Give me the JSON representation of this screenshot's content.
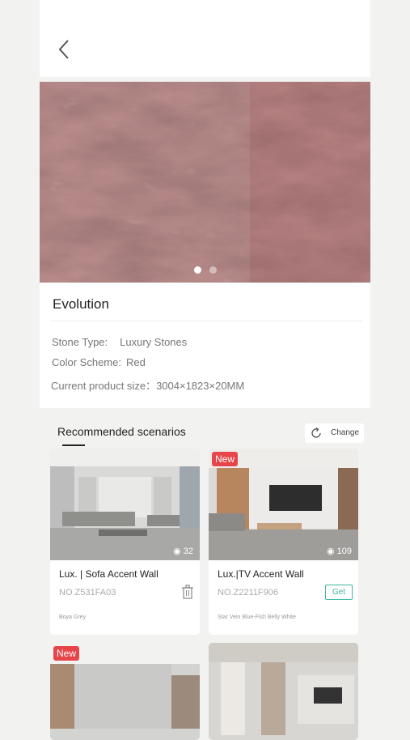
{
  "product": {
    "name": "Evolution",
    "specs": [
      {
        "label": "Stone Type:",
        "value": "Luxury Stones"
      },
      {
        "label": "Color Scheme:",
        "value": "Red"
      },
      {
        "label": "Current product size：",
        "value": "3004×1823×20MM"
      }
    ],
    "carousel": {
      "count": 2,
      "active": 1
    }
  },
  "recommended": {
    "title": "Recommended scenarios",
    "change_label": "Change",
    "cards": [
      {
        "name": "Lux. | Sofa Accent Wall",
        "code": "NO.Z531FA03",
        "stone": "Boya Grey",
        "views": "32",
        "badge": "",
        "action": "delete-icon"
      },
      {
        "name": "Lux.|TV Accent Wall",
        "code": "NO.Z2211F906",
        "stone": "Star Vein Blue-Fish Belly White",
        "views": "109",
        "badge": "New",
        "action_label": "Get"
      },
      {
        "badge": "New"
      },
      {
        "badge": ""
      }
    ]
  },
  "colors": {
    "accent": "#3fb8a3",
    "badge": "#e6454a",
    "stone": "#7a4a48"
  },
  "icons": {
    "back": "back-arrow-icon",
    "change": "refresh-icon",
    "views": "eye-icon",
    "delete": "trash-icon"
  }
}
